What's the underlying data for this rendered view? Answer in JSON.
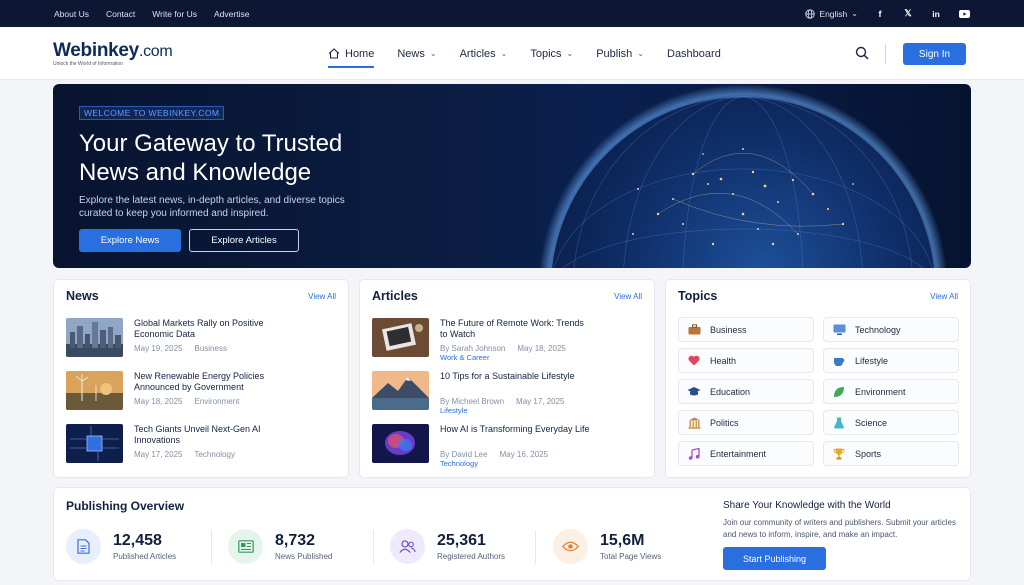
{
  "topbar": {
    "links": [
      "About Us",
      "Contact",
      "Write for Us",
      "Advertise"
    ],
    "language": "English",
    "social_icons": [
      "facebook-icon",
      "x-icon",
      "linkedin-icon",
      "youtube-icon"
    ]
  },
  "header": {
    "logo_name": "Webinkey",
    "logo_suffix": ".com",
    "logo_tagline": "Unlock the World of Information",
    "nav": [
      {
        "label": "Home",
        "active": true,
        "dropdown": false
      },
      {
        "label": "News",
        "dropdown": true
      },
      {
        "label": "Articles",
        "dropdown": true
      },
      {
        "label": "Topics",
        "dropdown": true
      },
      {
        "label": "Publish",
        "dropdown": true
      },
      {
        "label": "Dashboard",
        "dropdown": false
      }
    ],
    "signin_label": "Sign In"
  },
  "hero": {
    "welcome": "WELCOME TO WEBINKEY.COM",
    "title_line1": "Your Gateway to Trusted",
    "title_line2": "News and Knowledge",
    "description": "Explore the latest news, in-depth articles, and diverse topics curated to keep you informed and inspired.",
    "primary_button": "Explore News",
    "secondary_button": "Explore Articles"
  },
  "news": {
    "title": "News",
    "view_all": "View All",
    "items": [
      {
        "title": "Global Markets Rally on Positive Economic Data",
        "date": "May 19, 2025",
        "category": "Business"
      },
      {
        "title": "New Renewable Energy Policies Announced by Government",
        "date": "May 18, 2025",
        "category": "Environment"
      },
      {
        "title": "Tech Giants Unveil Next-Gen AI Innovations",
        "date": "May 17, 2025",
        "category": "Technology"
      }
    ]
  },
  "articles": {
    "title": "Articles",
    "view_all": "View All",
    "items": [
      {
        "title": "The Future of Remote Work: Trends to Watch",
        "author": "By Sarah Johnson",
        "date": "May 18, 2025",
        "category": "Work & Career"
      },
      {
        "title": "10 Tips for a Sustainable Lifestyle",
        "author": "By Micheel Brown",
        "date": "May 17, 2025",
        "category": "Lifestyle"
      },
      {
        "title": "How AI is Transforming Everyday Life",
        "author": "By David Lee",
        "date": "May 16, 2025",
        "category": "Technology"
      }
    ]
  },
  "topics": {
    "title": "Topics",
    "view_all": "View All",
    "items": [
      {
        "label": "Business",
        "icon": "briefcase-icon"
      },
      {
        "label": "Technology",
        "icon": "monitor-icon"
      },
      {
        "label": "Health",
        "icon": "heart-icon"
      },
      {
        "label": "Lifestyle",
        "icon": "teacup-icon"
      },
      {
        "label": "Education",
        "icon": "graduation-cap-icon"
      },
      {
        "label": "Environment",
        "icon": "leaf-icon"
      },
      {
        "label": "Politics",
        "icon": "government-building-icon"
      },
      {
        "label": "Science",
        "icon": "flask-icon"
      },
      {
        "label": "Entertainment",
        "icon": "music-note-icon"
      },
      {
        "label": "Sports",
        "icon": "trophy-icon"
      }
    ]
  },
  "overview": {
    "title": "Publishing Overview",
    "stats": [
      {
        "value": "12,458",
        "label": "Published Articles",
        "icon": "document-icon"
      },
      {
        "value": "8,732",
        "label": "News Published",
        "icon": "newspaper-icon"
      },
      {
        "value": "25,361",
        "label": "Registered Authors",
        "icon": "users-icon"
      },
      {
        "value": "15,6M",
        "label": "Total Page Views",
        "icon": "eye-icon"
      }
    ],
    "share_title": "Share Your Knowledge with the World",
    "share_text": "Join our community of writers and publishers. Submit your articles and news to inform, inspire, and make an impact.",
    "share_button": "Start Publishing"
  },
  "colors": {
    "accent": "#2a6fe0",
    "topbar": "#0b1733",
    "hero": "#0a1a3c"
  }
}
